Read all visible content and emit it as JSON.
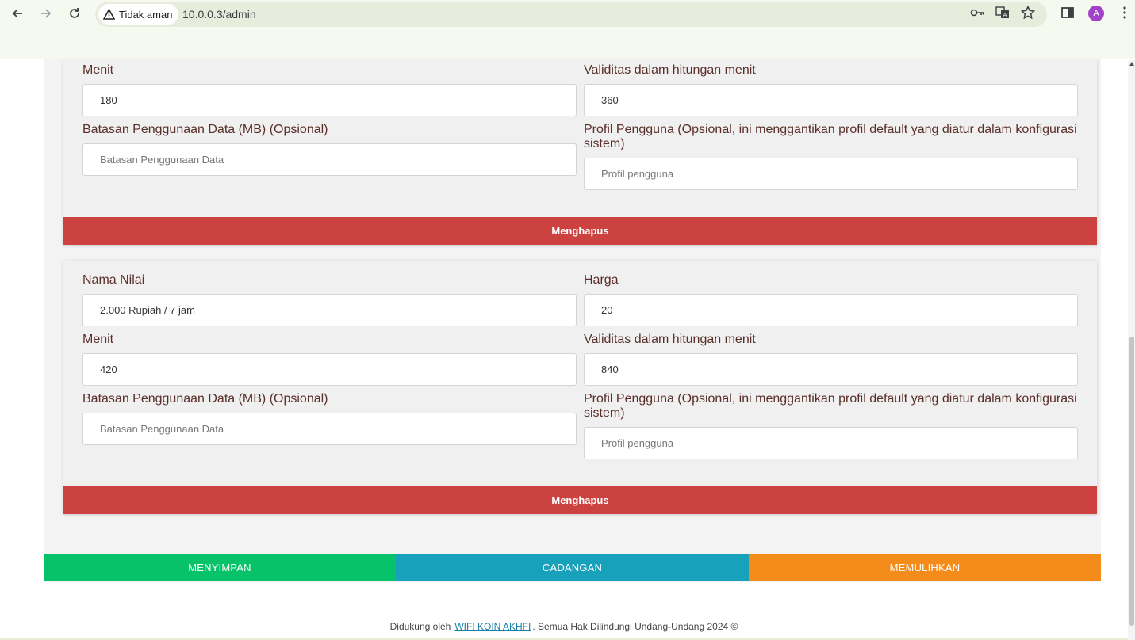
{
  "browser": {
    "security_label": "Tidak aman",
    "url": "10.0.0.3/admin",
    "profile_initial": "A"
  },
  "cards": [
    {
      "minutes_label": "Menit",
      "minutes_value": "180",
      "validity_label": "Validitas dalam hitungan menit",
      "validity_value": "360",
      "data_limit_label": "Batasan Penggunaan Data (MB) (Opsional)",
      "data_limit_placeholder": "Batasan Penggunaan Data",
      "profile_label": "Profil Pengguna (Opsional, ini menggantikan profil default yang diatur dalam konfigurasi sistem)",
      "profile_placeholder": "Profil pengguna",
      "delete_label": "Menghapus"
    },
    {
      "name_label": "Nama Nilai",
      "name_value": "2.000 Rupiah / 7 jam",
      "price_label": "Harga",
      "price_value": "20",
      "minutes_label": "Menit",
      "minutes_value": "420",
      "validity_label": "Validitas dalam hitungan menit",
      "validity_value": "840",
      "data_limit_label": "Batasan Penggunaan Data (MB) (Opsional)",
      "data_limit_placeholder": "Batasan Penggunaan Data",
      "profile_label": "Profil Pengguna (Opsional, ini menggantikan profil default yang diatur dalam konfigurasi sistem)",
      "profile_placeholder": "Profil pengguna",
      "delete_label": "Menghapus"
    }
  ],
  "actions": {
    "save": "MENYIMPAN",
    "backup": "CADANGAN",
    "restore": "MEMULIHKAN"
  },
  "footer": {
    "prefix": "Didukung oleh",
    "link": "WIFI KOIN AKHFI",
    "suffix": ". Semua Hak Dilindungi Undang-Undang 2024 ©"
  },
  "colors": {
    "delete": "#cc4240",
    "save": "#08c26a",
    "backup": "#17a1bb",
    "restore": "#f48c1c",
    "label_text": "#5a2f2a"
  }
}
